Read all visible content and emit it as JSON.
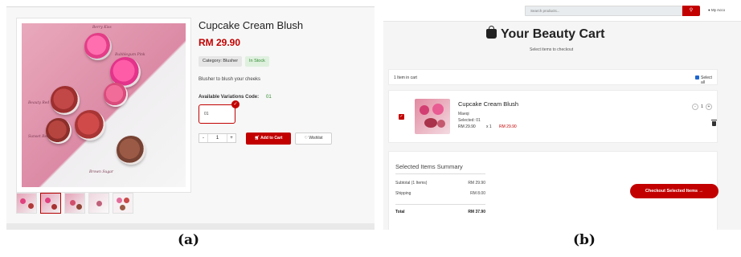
{
  "captions": {
    "a": "(a)",
    "b": "(b)"
  },
  "product_page": {
    "title": "Cupcake Cream Blush",
    "price": "RM 29.90",
    "category_badge": "Category: Blusher",
    "stock_badge": "In Stock",
    "description": "Blusher to blush your cheeks",
    "variations_label": "Available Variations Code:",
    "variations_count": "01",
    "selected_variation": "01",
    "quantity": "1",
    "quantity_minus": "-",
    "quantity_plus": "+",
    "add_to_cart_label": "Add to Cart",
    "wishlist_label": "Wishlist",
    "image_labels": [
      "Berry Kiss",
      "Bubblegum Pink",
      "Beauty Red",
      "Sunset Red",
      "Brown Sugar"
    ],
    "thumbnail_count": 5
  },
  "cart_page": {
    "search_placeholder": "Search products...",
    "account_label": "My Acco",
    "title": "Your Beauty Cart",
    "subtitle": "Select items to checkout",
    "items_count_label": "1 Item in cart",
    "select_all_label": "Select all",
    "item": {
      "name": "Cupcake Cream Blush",
      "brand": "Maeqi",
      "selected": "Selected: 01",
      "unit_price": "RM 29.90",
      "qty_text": "x 1",
      "line_total": "RM 29.90",
      "qty": "1",
      "minus": "-",
      "plus": "+"
    },
    "summary": {
      "title": "Selected Items Summary",
      "subtotal_label": "Subtotal (1 Items)",
      "subtotal_value": "RM 29.90",
      "shipping_label": "Shipping",
      "shipping_value": "RM 8.00",
      "total_label": "Total",
      "total_value": "RM 37.90"
    },
    "checkout_label": "Checkout Selected Items →"
  },
  "colors": {
    "accent": "#c20000",
    "in_stock": "#2f8a2f",
    "checkbox_blue": "#1e66d0"
  }
}
